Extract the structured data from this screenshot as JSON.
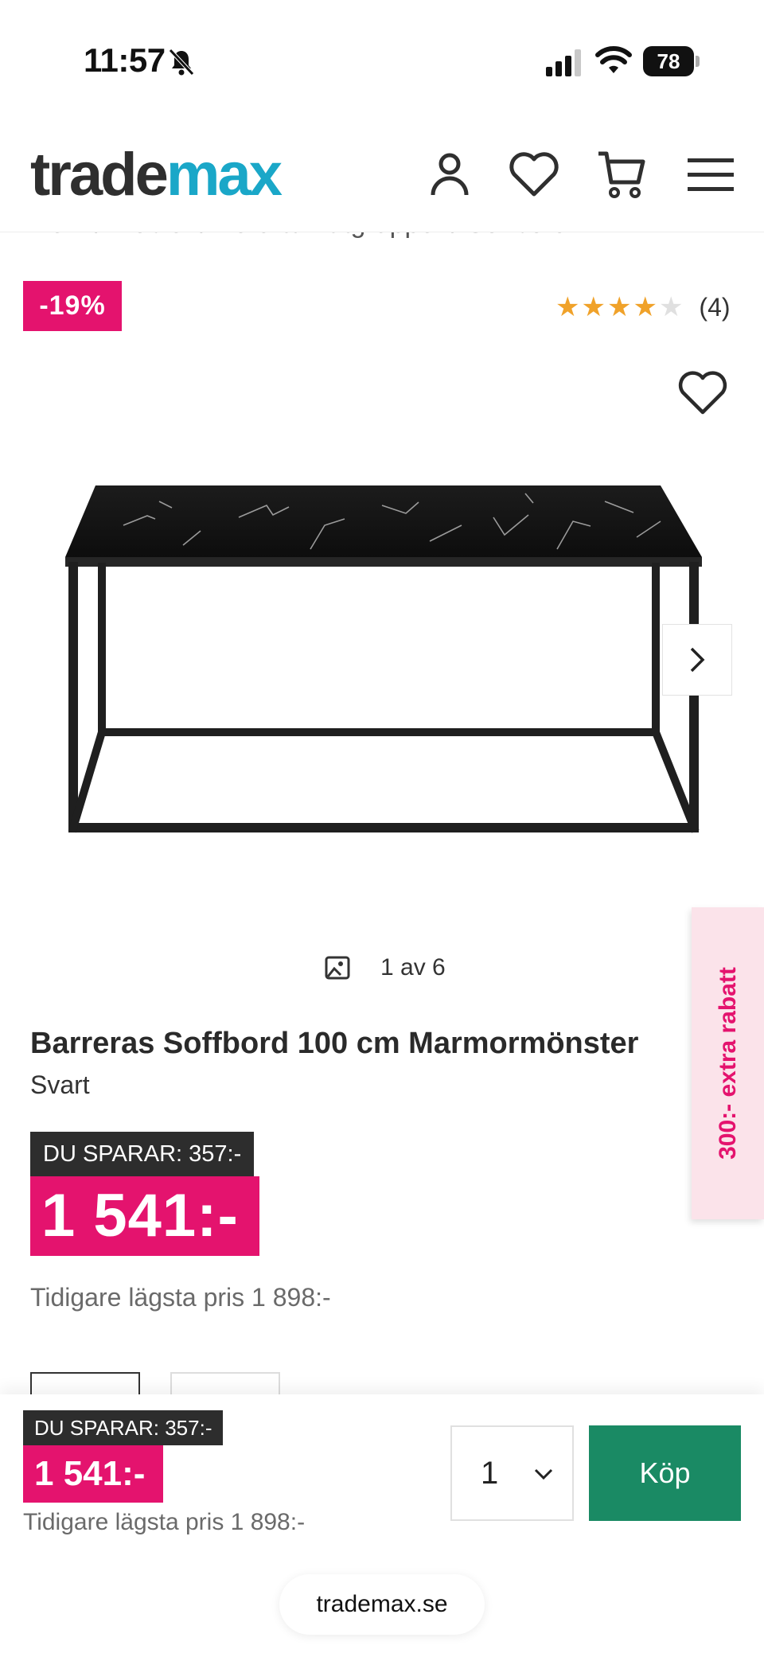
{
  "status_bar": {
    "time": "11:57",
    "battery": "78",
    "icons": [
      "bell-slash-icon",
      "signal-icon",
      "wifi-icon",
      "battery-icon"
    ]
  },
  "header": {
    "logo_part1": "trade",
    "logo_part2": "max",
    "icons": [
      "account-icon",
      "wishlist-icon",
      "cart-icon",
      "menu-icon"
    ],
    "colors": {
      "logo_dark": "#2f2f2f",
      "logo_accent": "#1aa7c8"
    }
  },
  "breadcrumb": "Hem  /  Möbler  /  Bord & matgrupper  /  Soffbord",
  "product": {
    "discount_badge": "-19%",
    "rating": {
      "stars": 4,
      "max": 5,
      "count": "(4)"
    },
    "gallery": {
      "counter": "1 av 6"
    },
    "promo_tab": "300:- extra rabatt",
    "title": "Barreras Soffbord 100 cm Marmormönster",
    "color": "Svart",
    "savings": "DU SPARAR: 357:-",
    "price": "1 541:-",
    "lowest_price": "Tidigare lägsta pris 1 898:-"
  },
  "sticky_bar": {
    "savings": "DU SPARAR: 357:-",
    "price": "1 541:-",
    "lowest_price": "Tidigare lägsta pris 1 898:-",
    "quantity": "1",
    "buy_label": "Köp"
  },
  "browser": {
    "url": "trademax.se"
  },
  "colors": {
    "accent_pink": "#e4136e",
    "buy_green": "#1a8a64",
    "star_orange": "#f0a22a"
  }
}
